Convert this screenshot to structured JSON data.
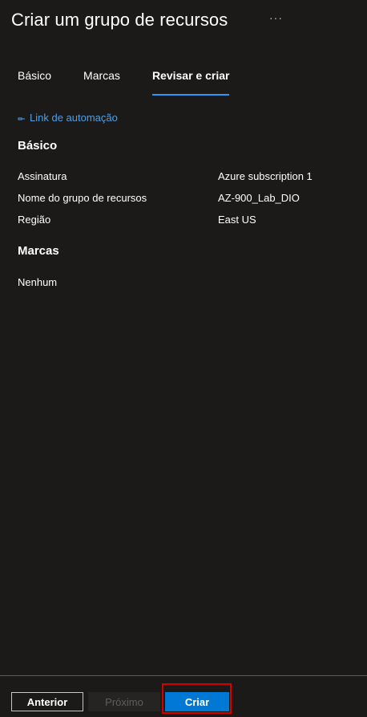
{
  "header": {
    "title": "Criar um grupo de recursos",
    "more_label": "···"
  },
  "tabs": [
    {
      "label": "Básico",
      "active": false
    },
    {
      "label": "Marcas",
      "active": false
    },
    {
      "label": "Revisar e criar",
      "active": true
    }
  ],
  "automation_link": {
    "icon": "automation-link-icon",
    "label": "Link de automação"
  },
  "basico": {
    "heading": "Básico",
    "rows": [
      {
        "label": "Assinatura",
        "value": "Azure subscription 1"
      },
      {
        "label": "Nome do grupo de recursos",
        "value": "AZ-900_Lab_DIO"
      },
      {
        "label": "Região",
        "value": "East US"
      }
    ]
  },
  "marcas": {
    "heading": "Marcas",
    "empty_text": "Nenhum"
  },
  "footer": {
    "anterior_label": "Anterior",
    "proximo_label": "Próximo",
    "criar_label": "Criar"
  },
  "colors": {
    "background": "#1b1a19",
    "accent": "#0078d4",
    "link": "#4f9fe7",
    "tab_underline": "#2899f5",
    "highlight": "#d20000"
  }
}
